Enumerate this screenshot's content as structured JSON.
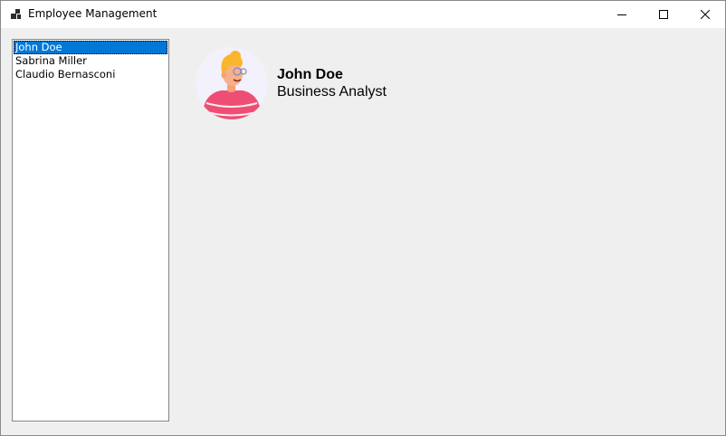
{
  "window": {
    "title": "Employee Management",
    "app_icon": "winforms-app-icon",
    "controls": {
      "minimize_icon": "minimize-icon",
      "maximize_icon": "maximize-icon",
      "close_icon": "close-icon"
    }
  },
  "employee_list": {
    "selected_index": 0,
    "items": [
      {
        "label": "John Doe"
      },
      {
        "label": "Sabrina Miller"
      },
      {
        "label": "Claudio Bernasconi"
      }
    ]
  },
  "details": {
    "avatar_icon": "person-avatar-icon",
    "name": "John Doe",
    "job_title": "Business Analyst"
  },
  "colors": {
    "selection": "#0078d7",
    "window_bg": "#efefef",
    "avatar_bg": "#f3f1fb",
    "shirt": "#ee4e74",
    "hair": "#f9b52c"
  }
}
